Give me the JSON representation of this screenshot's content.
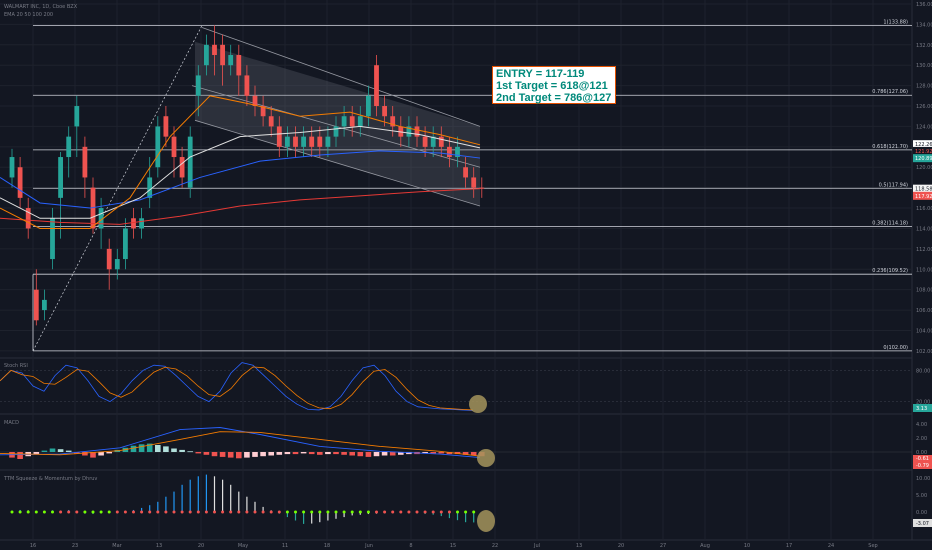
{
  "header": {
    "symbol": "WALMART INC, 1D, Cboe BZX",
    "ema_label": "EMA 20 50 100 200"
  },
  "entry_box": {
    "line1": "ENTRY = 117-119",
    "line2": "1st Target = 618@121",
    "line3": "2nd Target = 786@127"
  },
  "fib_levels": [
    {
      "label": "1(133.88)",
      "price": 133.88
    },
    {
      "label": "0.786(127.06)",
      "price": 127.06
    },
    {
      "label": "0.618(121.70)",
      "price": 121.7
    },
    {
      "label": "0.5(117.94)",
      "price": 117.94
    },
    {
      "label": "0.382(114.18)",
      "price": 114.18
    },
    {
      "label": "0.236(109.52)",
      "price": 109.52
    },
    {
      "label": "0(102.00)",
      "price": 102.0
    }
  ],
  "price_axis": {
    "ticks": [
      "136.00",
      "134.00",
      "132.00",
      "130.00",
      "128.00",
      "126.00",
      "124.00",
      "122.00",
      "120.00",
      "118.00",
      "116.00",
      "114.00",
      "112.00",
      "110.00",
      "108.00",
      "106.00",
      "104.00",
      "102.00"
    ],
    "badges": [
      {
        "text": "122.26",
        "color": "#ffffff",
        "text_color": "#131722",
        "price": 122.26
      },
      {
        "text": "121.92",
        "color": "#131722",
        "text_color": "#ef5350",
        "price": 121.6
      },
      {
        "text": "120.89",
        "color": "#26a69a",
        "text_color": "#ffffff",
        "price": 120.89
      },
      {
        "text": "118.58",
        "color": "#f5f5f5",
        "text_color": "#131722",
        "price": 117.9
      },
      {
        "text": "117.92",
        "color": "#ef5350",
        "text_color": "#ffffff",
        "price": 117.2
      }
    ]
  },
  "rsi_pane": {
    "title": "Stoch RSI",
    "ticks": [
      "80.00",
      "20.00"
    ],
    "badge": "3.13",
    "badge_color": "#26a69a"
  },
  "macd_pane": {
    "title": "MACD",
    "ticks": [
      "4.00",
      "2.00",
      "0.00",
      "-2.00"
    ],
    "badges": [
      {
        "text": "-0.61",
        "color": "#ef5350"
      },
      {
        "text": "-0.79",
        "color": "#ef5350"
      }
    ]
  },
  "squeeze_pane": {
    "title": "TTM Squeeze & Momentum by Dhruv",
    "ticks": [
      "10.00",
      "5.00",
      "0.00"
    ],
    "badge": "-3.07"
  },
  "time_axis": [
    "16",
    "23",
    "Mar",
    "13",
    "20",
    "May",
    "11",
    "18",
    "Jun",
    "8",
    "15",
    "22",
    "Jul",
    "13",
    "20",
    "27",
    "Aug",
    "10",
    "17",
    "24",
    "Sep"
  ],
  "colors": {
    "background": "#131722",
    "up": "#26a69a",
    "down": "#ef5350",
    "fib_line": "#d1d4dc",
    "channel": "#5d606b",
    "ema_orange": "#f57c00",
    "ema_red": "#e53935",
    "ema_white": "#e0e0e0",
    "ema_blue": "#2962ff",
    "highlight": "#a4945c"
  }
}
